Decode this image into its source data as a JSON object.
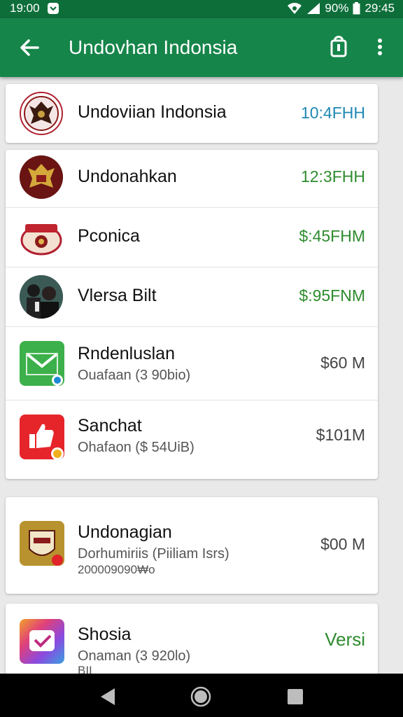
{
  "status_bar": {
    "time_left": "19:00",
    "battery": "90%",
    "time_right": "29:45"
  },
  "app_bar": {
    "title": "Undovhan Indonsia"
  },
  "top_item": {
    "name": "Undoviian Indonsia",
    "value": "10:4FHH"
  },
  "list": [
    {
      "name": "Undonahkan",
      "value": "12:3FHH"
    },
    {
      "name": "Pconica",
      "value": "$:45FHM"
    },
    {
      "name": "Vlersa Bilt",
      "value": "$:95FNM"
    },
    {
      "name": "Rndenluslan",
      "sub": "Ouafaan (3 90bio)",
      "value": "$60 M"
    },
    {
      "name": "Sanchat",
      "sub": "Ohafaon ($ 54UiB)",
      "value": "$101M"
    }
  ],
  "card3": {
    "name": "Undonagian",
    "sub": "Dorhumiriis (Piiliam Isrs)",
    "sub2": "200009090₩o",
    "value": "$00 M"
  },
  "card4": {
    "name": "Shosia",
    "sub": "Onaman (3 920lo)",
    "sub2": "BII",
    "value": "Versi"
  },
  "colors": {
    "status_bar": "#0e6e3a",
    "app_bar": "#16854a",
    "accent_blue": "#1e88b4",
    "accent_green": "#2e8b2e"
  },
  "icons": [
    "back-arrow-icon",
    "bag-icon",
    "more-vert-icon",
    "wifi-icon",
    "signal-icon",
    "battery-icon",
    "nav-back-icon",
    "nav-home-icon",
    "nav-recents-icon"
  ]
}
